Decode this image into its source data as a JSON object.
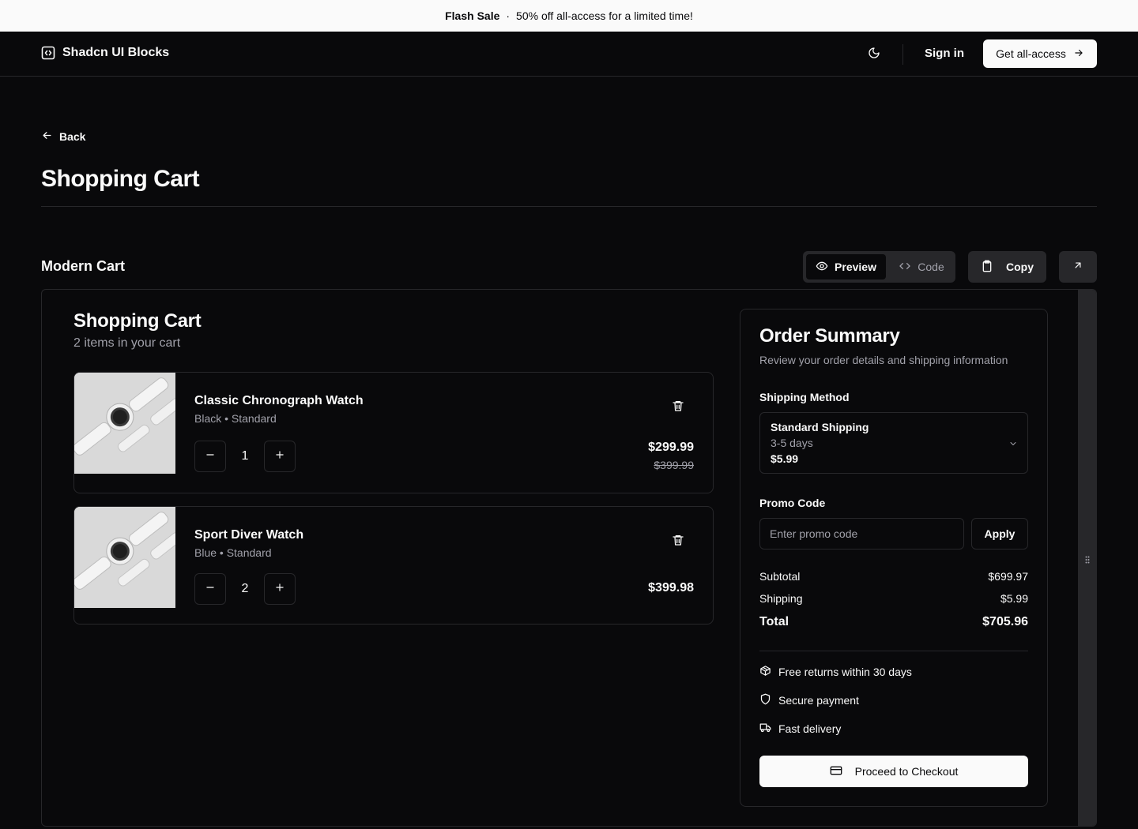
{
  "banner": {
    "highlight": "Flash Sale",
    "separator": "·",
    "message": "50% off all-access for a limited time!"
  },
  "nav": {
    "brand": "Shadcn UI Blocks",
    "sign_in": "Sign in",
    "cta": "Get all-access"
  },
  "page": {
    "back": "Back",
    "title": "Shopping Cart"
  },
  "block": {
    "title": "Modern Cart",
    "preview_label": "Preview",
    "code_label": "Code",
    "copy_label": "Copy"
  },
  "cart": {
    "title": "Shopping Cart",
    "subtitle": "2 items in your cart",
    "items": [
      {
        "name": "Classic Chronograph Watch",
        "variant": "Black • Standard",
        "quantity": "1",
        "price": "$299.99",
        "original_price": "$399.99"
      },
      {
        "name": "Sport Diver Watch",
        "variant": "Blue • Standard",
        "quantity": "2",
        "price": "$399.98",
        "original_price": ""
      }
    ]
  },
  "summary": {
    "title": "Order Summary",
    "description": "Review your order details and shipping information",
    "shipping_label": "Shipping Method",
    "shipping_option": {
      "name": "Standard Shipping",
      "days": "3-5 days",
      "price": "$5.99"
    },
    "promo_label": "Promo Code",
    "promo_placeholder": "Enter promo code",
    "apply_label": "Apply",
    "subtotal_label": "Subtotal",
    "subtotal_value": "$699.97",
    "shipping_cost_label": "Shipping",
    "shipping_cost_value": "$5.99",
    "total_label": "Total",
    "total_value": "$705.96",
    "features": [
      "Free returns within 30 days",
      "Secure payment",
      "Fast delivery"
    ],
    "checkout_label": "Proceed to Checkout"
  }
}
